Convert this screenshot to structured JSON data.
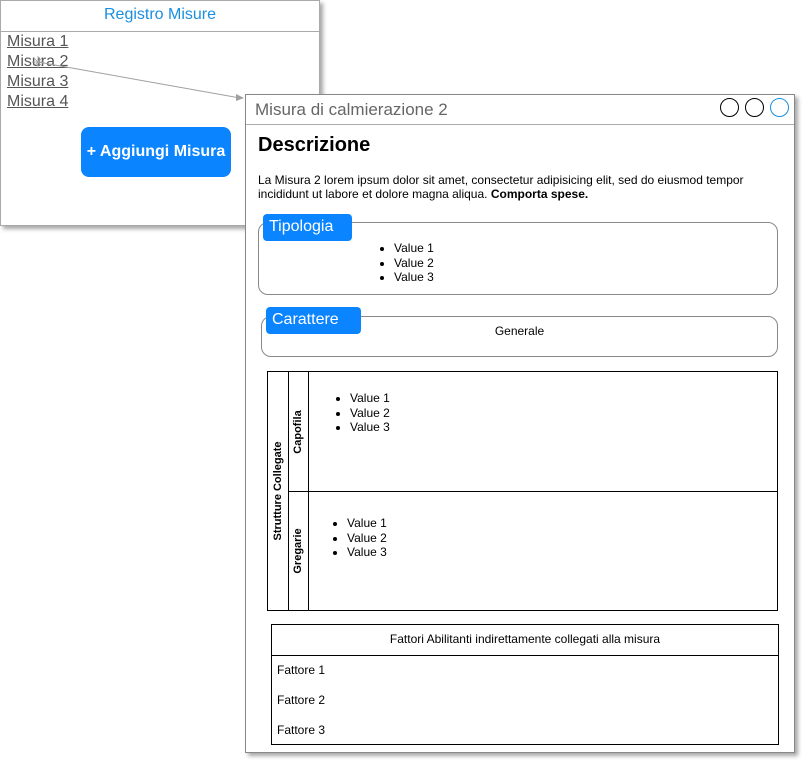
{
  "registro": {
    "title": "Registro Misure",
    "items": [
      "Misura 1",
      "Misura 2",
      "Misura 3",
      "Misura 4"
    ],
    "add_button": "+ Aggiungi Misura"
  },
  "detail": {
    "window_title": "Misura di calmierazione 2",
    "heading": "Descrizione",
    "description": "La Misura 2 lorem ipsum dolor sit amet, consectetur adipisicing elit, sed do eiusmod tempor incididunt ut labore et dolore magna aliqua.",
    "description_bold": "Comporta spese.",
    "tipologia": {
      "label": "Tipologia",
      "values": [
        "Value 1",
        "Value 2",
        "Value 3"
      ]
    },
    "carattere": {
      "label": "Carattere",
      "value": "Generale"
    },
    "strutture": {
      "label": "Strutture Collegate",
      "capofila": {
        "label": "Capofila",
        "values": [
          "Value 1",
          "Value 2",
          "Value 3"
        ]
      },
      "gregarie": {
        "label": "Gregarie",
        "values": [
          "Value 1",
          "Value 2",
          "Value 3"
        ]
      }
    },
    "fattori": {
      "header": "Fattori Abilitanti indirettamente collegati alla misura",
      "items": [
        "Fattore 1",
        "Fattore 2",
        "Fattore 3"
      ]
    }
  },
  "colors": {
    "accent": "#0a84ff",
    "title_blue": "#1a8fe0"
  }
}
